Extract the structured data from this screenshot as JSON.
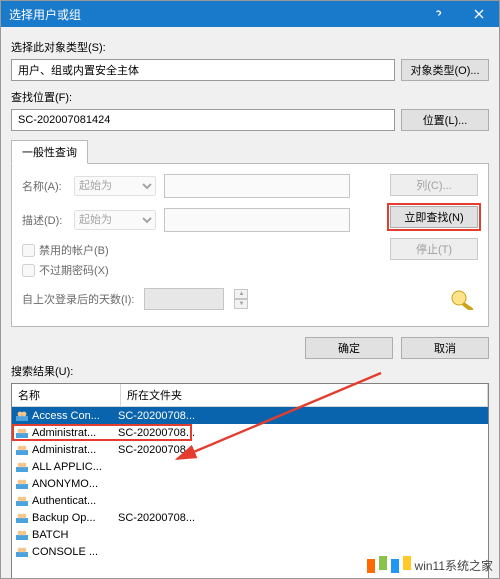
{
  "titlebar": {
    "title": "选择用户或组"
  },
  "section1": {
    "label": "选择此对象类型(S):",
    "value": "用户、组或内置安全主体",
    "button": "对象类型(O)..."
  },
  "section2": {
    "label": "查找位置(F):",
    "value": "SC-202007081424",
    "button": "位置(L)..."
  },
  "tab": {
    "label": "一般性查询"
  },
  "form": {
    "name_label": "名称(A):",
    "desc_label": "描述(D):",
    "match_option": "起始为",
    "chk_disabled": "禁用的帐户(B)",
    "chk_noexpire": "不过期密码(X)",
    "days_label": "自上次登录后的天数(I):"
  },
  "side_buttons": {
    "columns": "列(C)...",
    "findnow": "立即查找(N)",
    "stop": "停止(T)"
  },
  "footer": {
    "ok": "确定",
    "cancel": "取消"
  },
  "results": {
    "label": "搜索结果(U):",
    "col_name": "名称",
    "col_folder": "所在文件夹",
    "rows": [
      {
        "name": "Access Con...",
        "folder": "SC-20200708...",
        "sel": true
      },
      {
        "name": "Administrat...",
        "folder": "SC-20200708...",
        "hl": true
      },
      {
        "name": "Administrat...",
        "folder": "SC-20200708..."
      },
      {
        "name": "ALL APPLIC...",
        "folder": ""
      },
      {
        "name": "ANONYMO...",
        "folder": ""
      },
      {
        "name": "Authenticat...",
        "folder": ""
      },
      {
        "name": "Backup Op...",
        "folder": "SC-20200708..."
      },
      {
        "name": "BATCH",
        "folder": ""
      },
      {
        "name": "CONSOLE ...",
        "folder": ""
      }
    ]
  },
  "watermark": {
    "text": "win11系统之家"
  },
  "colors": {
    "titlebar": "#1979ca",
    "highlight": "#e43c2f",
    "selection": "#0a64ad"
  }
}
